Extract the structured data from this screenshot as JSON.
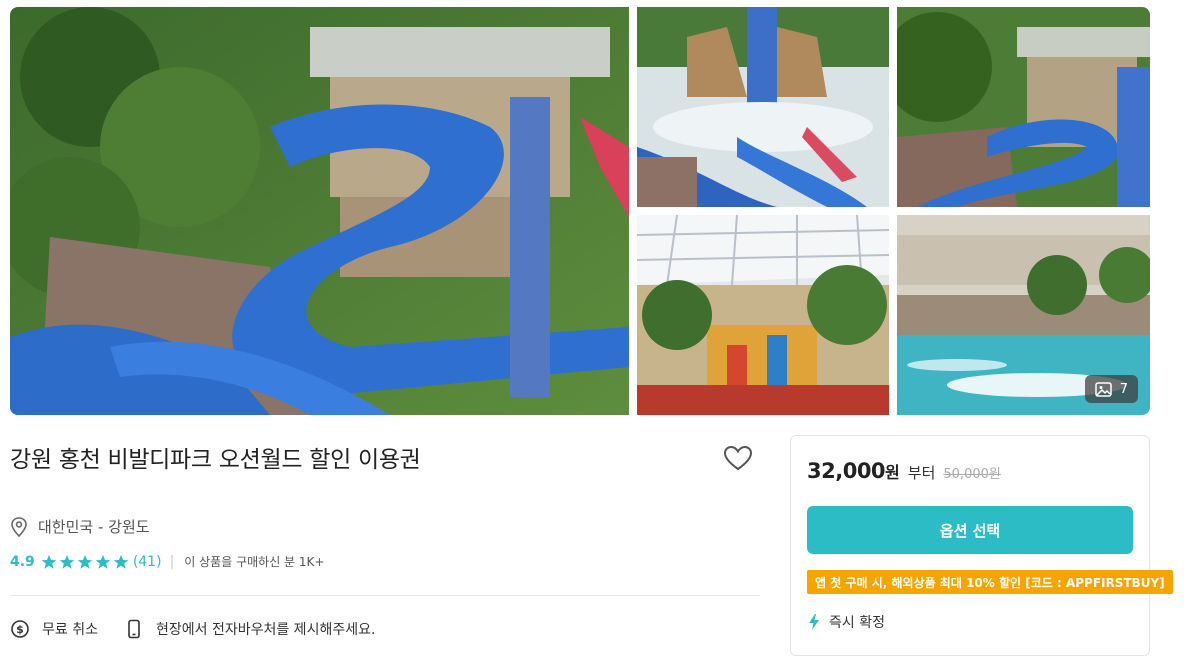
{
  "gallery": {
    "photo_count": "7",
    "photos": [
      "waterslide-tower-aerial",
      "sphinx-waterslides",
      "slide-tower-closeup",
      "indoor-pool-palms",
      "indoor-wave-pool"
    ]
  },
  "product": {
    "title": "강원 홍천 비발디파크 오션월드 할인 이용권",
    "location": "대한민국 - 강원도",
    "rating": {
      "score": "4.9",
      "stars": 5,
      "review_count": "(41)",
      "separator": "|",
      "buyers_text": "이 상품을 구매하신 분 1K+"
    },
    "features": {
      "free_cancel": "무료 취소",
      "voucher": "현장에서 전자바우처를 제시해주세요."
    }
  },
  "purchase": {
    "price": "32,000",
    "currency_unit": "원",
    "from_label": "부터",
    "original_price": "50,000원",
    "option_button": "옵션 선택",
    "promo": "앱 첫 구매 시, 해외상품 최대 10% 할인 [코드 : APPFIRSTBUY]",
    "instant_confirm": "즉시 확정"
  },
  "colors": {
    "accent": "#2bbcc6",
    "promo": "#f6a500",
    "star": "#2bbcc6"
  }
}
